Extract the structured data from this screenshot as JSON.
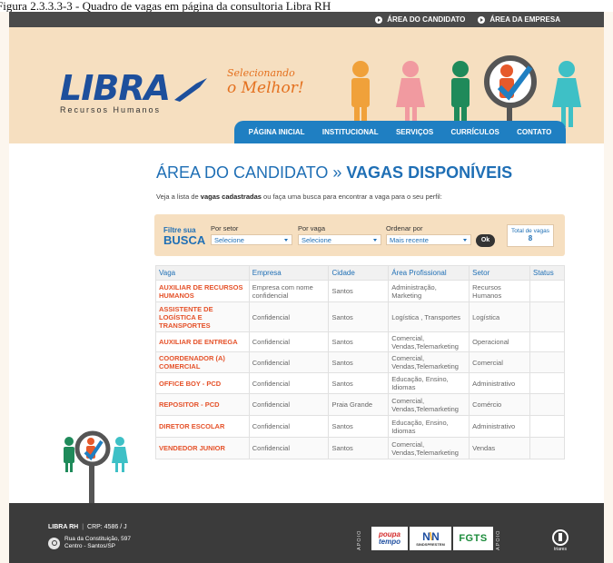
{
  "caption": "Figura 2.3.3.3-3 - Quadro de vagas em página da consultoria Libra RH",
  "topbar": {
    "area_candidato": "ÁREA DO CANDIDATO",
    "area_empresa": "ÁREA DA EMPRESA"
  },
  "header": {
    "logo_word": "LIBRA",
    "logo_sub": "Recursos Humanos",
    "slogan_line1": "Selecionando",
    "slogan_line2": "o Melhor!"
  },
  "nav": {
    "items": [
      "PÁGINA INICIAL",
      "INSTITUCIONAL",
      "SERVIÇOS",
      "CURRÍCULOS",
      "CONTATO"
    ]
  },
  "page": {
    "title_light": "ÁREA DO CANDIDATO » ",
    "title_bold": "VAGAS DISPONÍVEIS",
    "intro_pre": "Veja a lista de ",
    "intro_bold": "vagas cadastradas",
    "intro_post": " ou faça uma busca para encontrar a vaga para o seu perfil:"
  },
  "filter": {
    "label_top": "Filtre sua",
    "label_big": "BUSCA",
    "setor_label": "Por setor",
    "setor_value": "Selecione",
    "vaga_label": "Por vaga",
    "vaga_value": "Selecione",
    "ordenar_label": "Ordenar por",
    "ordenar_value": "Mais recente",
    "ok_label": "Ok",
    "total_label": "Total de vagas",
    "total_value": "8"
  },
  "table": {
    "headers": [
      "Vaga",
      "Empresa",
      "Cidade",
      "Área Profissional",
      "Setor",
      "Status"
    ],
    "rows": [
      [
        "AUXILIAR DE RECURSOS HUMANOS",
        "Empresa com nome confidencial",
        "Santos",
        "Administração, Marketing",
        "Recursos Humanos",
        ""
      ],
      [
        "ASSISTENTE DE LOGÍSTICA E TRANSPORTES",
        "Confidencial",
        "Santos",
        "Logística , Transportes",
        "Logística",
        ""
      ],
      [
        "AUXILIAR DE ENTREGA",
        "Confidencial",
        "Santos",
        "Comercial, Vendas,Telemarketing",
        "Operacional",
        ""
      ],
      [
        "COORDENADOR (A) COMERCIAL",
        "Confidencial",
        "Santos",
        "Comercial, Vendas,Telemarketing",
        "Comercial",
        ""
      ],
      [
        "OFFICE BOY - PCD",
        "Confidencial",
        "Santos",
        "Educação, Ensino, Idiomas",
        "Administrativo",
        ""
      ],
      [
        "REPOSITOR - PCD",
        "Confidencial",
        "Praia Grande",
        "Comercial, Vendas,Telemarketing",
        "Comércio",
        ""
      ],
      [
        "DIRETOR ESCOLAR",
        "Confidencial",
        "Santos",
        "Educação, Ensino, Idiomas",
        "Administrativo",
        ""
      ],
      [
        "VENDEDOR JUNIOR",
        "Confidencial",
        "Santos",
        "Comercial, Vendas,Telemarketing",
        "Vendas",
        ""
      ]
    ]
  },
  "footer": {
    "brand": "LIBRA RH",
    "crp": "CRP: 4586 / J",
    "address_line1": "Rua da Constituição, 597",
    "address_line2": "Centro - Santos/SP",
    "apoio": "APOIO",
    "sponsor1_a": "poupa",
    "sponsor1_b": "tempo",
    "sponsor2_small": "SINDSPRESTEM",
    "sponsor3": "FGTS",
    "triares": "triares"
  }
}
